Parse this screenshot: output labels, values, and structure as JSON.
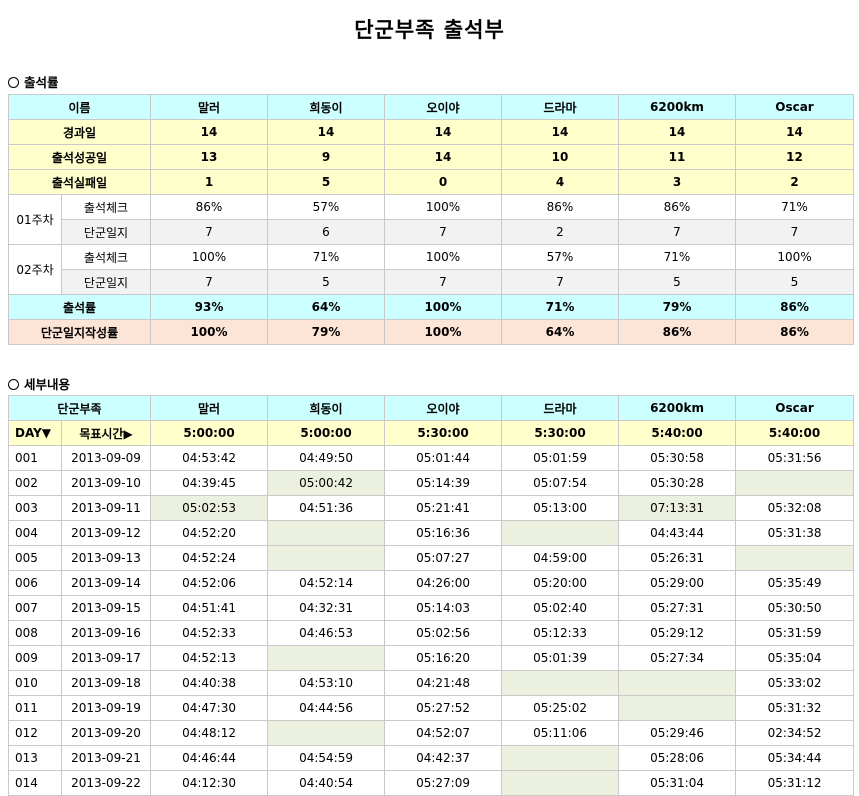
{
  "title": "단군부족 출석부",
  "summary": {
    "section_label": "출석률",
    "name_header": "이름",
    "members": [
      "말러",
      "희동이",
      "오이야",
      "드라마",
      "6200km",
      "Oscar"
    ],
    "rows_main": [
      {
        "label": "경과일",
        "values": [
          "14",
          "14",
          "14",
          "14",
          "14",
          "14"
        ]
      },
      {
        "label": "출석성공일",
        "values": [
          "13",
          "9",
          "14",
          "10",
          "11",
          "12"
        ]
      },
      {
        "label": "출석실패일",
        "values": [
          "1",
          "5",
          "0",
          "4",
          "3",
          "2"
        ]
      }
    ],
    "weeks": [
      {
        "label": "01주차",
        "check_label": "출석체크",
        "check": [
          "86%",
          "57%",
          "100%",
          "86%",
          "86%",
          "71%"
        ],
        "log_label": "단군일지",
        "log": [
          "7",
          "6",
          "7",
          "2",
          "7",
          "7"
        ]
      },
      {
        "label": "02주차",
        "check_label": "출석체크",
        "check": [
          "100%",
          "71%",
          "100%",
          "57%",
          "71%",
          "100%"
        ],
        "log_label": "단군일지",
        "log": [
          "7",
          "5",
          "7",
          "7",
          "5",
          "5"
        ]
      }
    ],
    "attendance_label": "출석률",
    "attendance": [
      "93%",
      "64%",
      "100%",
      "71%",
      "79%",
      "86%"
    ],
    "log_rate_label": "단군일지작성률",
    "log_rate": [
      "100%",
      "79%",
      "100%",
      "64%",
      "86%",
      "86%"
    ]
  },
  "detail": {
    "section_label": "세부내용",
    "tribe_header": "단군부족",
    "members": [
      "말러",
      "희동이",
      "오이야",
      "드라마",
      "6200km",
      "Oscar"
    ],
    "day_label": "DAY▼",
    "target_label": "목표시간▶",
    "targets": [
      "5:00:00",
      "5:00:00",
      "5:30:00",
      "5:30:00",
      "5:40:00",
      "5:40:00"
    ],
    "rows": [
      {
        "day": "001",
        "date": "2013-09-09",
        "times": [
          "04:53:42",
          "04:49:50",
          "05:01:44",
          "05:01:59",
          "05:30:58",
          "05:31:56"
        ],
        "miss": [
          false,
          false,
          false,
          false,
          false,
          false
        ]
      },
      {
        "day": "002",
        "date": "2013-09-10",
        "times": [
          "04:39:45",
          "05:00:42",
          "05:14:39",
          "05:07:54",
          "05:30:28",
          ""
        ],
        "miss": [
          false,
          true,
          false,
          false,
          false,
          true
        ]
      },
      {
        "day": "003",
        "date": "2013-09-11",
        "times": [
          "05:02:53",
          "04:51:36",
          "05:21:41",
          "05:13:00",
          "07:13:31",
          "05:32:08"
        ],
        "miss": [
          true,
          false,
          false,
          false,
          true,
          false
        ]
      },
      {
        "day": "004",
        "date": "2013-09-12",
        "times": [
          "04:52:20",
          "",
          "05:16:36",
          "",
          "04:43:44",
          "05:31:38"
        ],
        "miss": [
          false,
          true,
          false,
          true,
          false,
          false
        ]
      },
      {
        "day": "005",
        "date": "2013-09-13",
        "times": [
          "04:52:24",
          "",
          "05:07:27",
          "04:59:00",
          "05:26:31",
          ""
        ],
        "miss": [
          false,
          true,
          false,
          false,
          false,
          true
        ]
      },
      {
        "day": "006",
        "date": "2013-09-14",
        "times": [
          "04:52:06",
          "04:52:14",
          "04:26:00",
          "05:20:00",
          "05:29:00",
          "05:35:49"
        ],
        "miss": [
          false,
          false,
          false,
          false,
          false,
          false
        ]
      },
      {
        "day": "007",
        "date": "2013-09-15",
        "times": [
          "04:51:41",
          "04:32:31",
          "05:14:03",
          "05:02:40",
          "05:27:31",
          "05:30:50"
        ],
        "miss": [
          false,
          false,
          false,
          false,
          false,
          false
        ]
      },
      {
        "day": "008",
        "date": "2013-09-16",
        "times": [
          "04:52:33",
          "04:46:53",
          "05:02:56",
          "05:12:33",
          "05:29:12",
          "05:31:59"
        ],
        "miss": [
          false,
          false,
          false,
          false,
          false,
          false
        ]
      },
      {
        "day": "009",
        "date": "2013-09-17",
        "times": [
          "04:52:13",
          "",
          "05:16:20",
          "05:01:39",
          "05:27:34",
          "05:35:04"
        ],
        "miss": [
          false,
          true,
          false,
          false,
          false,
          false
        ]
      },
      {
        "day": "010",
        "date": "2013-09-18",
        "times": [
          "04:40:38",
          "04:53:10",
          "04:21:48",
          "",
          "",
          "05:33:02"
        ],
        "miss": [
          false,
          false,
          false,
          true,
          true,
          false
        ]
      },
      {
        "day": "011",
        "date": "2013-09-19",
        "times": [
          "04:47:30",
          "04:44:56",
          "05:27:52",
          "05:25:02",
          "",
          "05:31:32"
        ],
        "miss": [
          false,
          false,
          false,
          false,
          true,
          false
        ]
      },
      {
        "day": "012",
        "date": "2013-09-20",
        "times": [
          "04:48:12",
          "",
          "04:52:07",
          "05:11:06",
          "05:29:46",
          "02:34:52"
        ],
        "miss": [
          false,
          true,
          false,
          false,
          false,
          false
        ]
      },
      {
        "day": "013",
        "date": "2013-09-21",
        "times": [
          "04:46:44",
          "04:54:59",
          "04:42:37",
          "",
          "05:28:06",
          "05:34:44"
        ],
        "miss": [
          false,
          false,
          false,
          true,
          false,
          false
        ]
      },
      {
        "day": "014",
        "date": "2013-09-22",
        "times": [
          "04:12:30",
          "04:40:54",
          "05:27:09",
          "",
          "05:31:04",
          "05:31:12"
        ],
        "miss": [
          false,
          false,
          false,
          true,
          false,
          false
        ]
      }
    ]
  },
  "colors": {
    "header_cyan": "#ccffff",
    "row_yellow": "#ffffcc",
    "log_rate_peach": "#fce4d6",
    "missed_green": "#ebf1de",
    "week_gray": "#f2f2f2",
    "grid": "#c9c9c9"
  }
}
